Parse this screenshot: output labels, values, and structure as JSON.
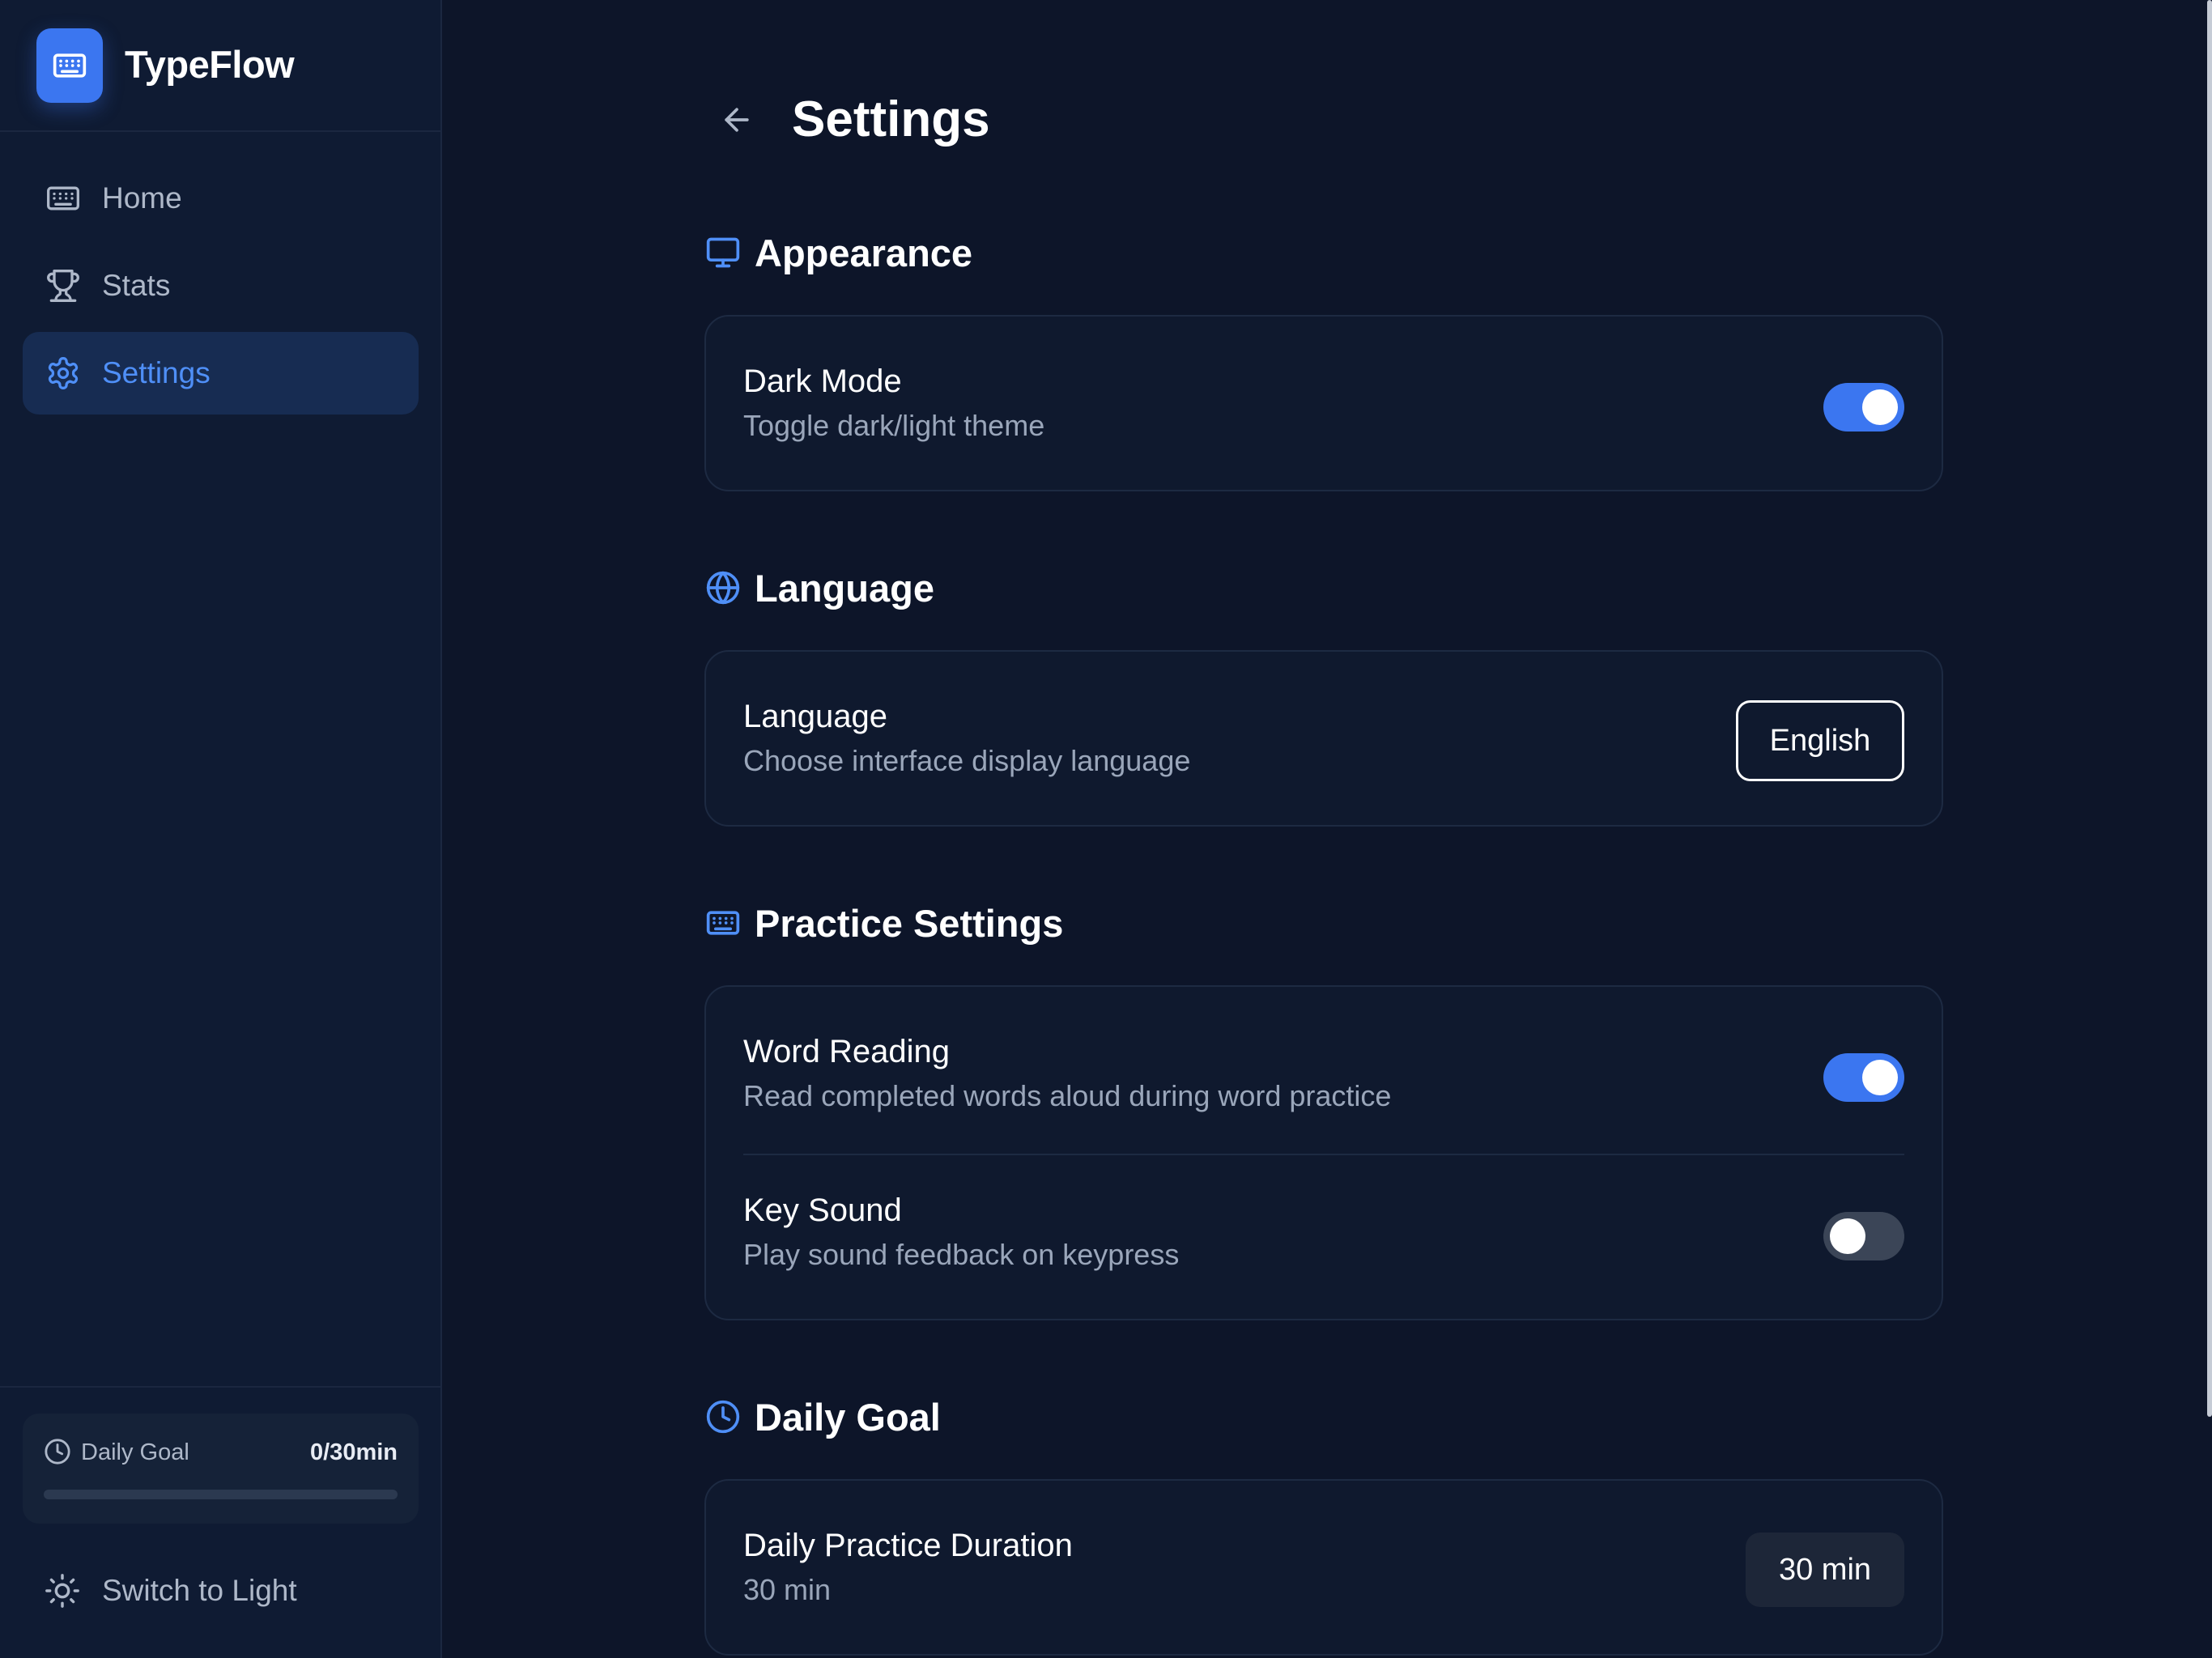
{
  "app": {
    "name": "TypeFlow",
    "logo_icon": "keyboard-icon",
    "accent_color": "#3b76f0"
  },
  "sidebar": {
    "items": [
      {
        "label": "Home",
        "icon": "keyboard-icon",
        "active": false
      },
      {
        "label": "Stats",
        "icon": "trophy-icon",
        "active": false
      },
      {
        "label": "Settings",
        "icon": "gear-icon",
        "active": true
      }
    ],
    "daily_goal": {
      "label": "Daily Goal",
      "value": "0/30min",
      "progress": 0
    },
    "theme_switch_label": "Switch to Light"
  },
  "page": {
    "title": "Settings",
    "back_icon": "arrow-left-icon"
  },
  "sections": {
    "appearance": {
      "title": "Appearance",
      "icon": "monitor-icon",
      "dark_mode": {
        "title": "Dark Mode",
        "description": "Toggle dark/light theme",
        "enabled": true
      }
    },
    "language": {
      "title": "Language",
      "icon": "globe-icon",
      "setting": {
        "title": "Language",
        "description": "Choose interface display language",
        "value": "English"
      }
    },
    "practice": {
      "title": "Practice Settings",
      "icon": "keyboard-icon",
      "word_reading": {
        "title": "Word Reading",
        "description": "Read completed words aloud during word practice",
        "enabled": true
      },
      "key_sound": {
        "title": "Key Sound",
        "description": "Play sound feedback on keypress",
        "enabled": false
      }
    },
    "daily_goal": {
      "title": "Daily Goal",
      "icon": "clock-icon",
      "duration": {
        "title": "Daily Practice Duration",
        "description": "30 min",
        "value": "30 min"
      }
    }
  }
}
